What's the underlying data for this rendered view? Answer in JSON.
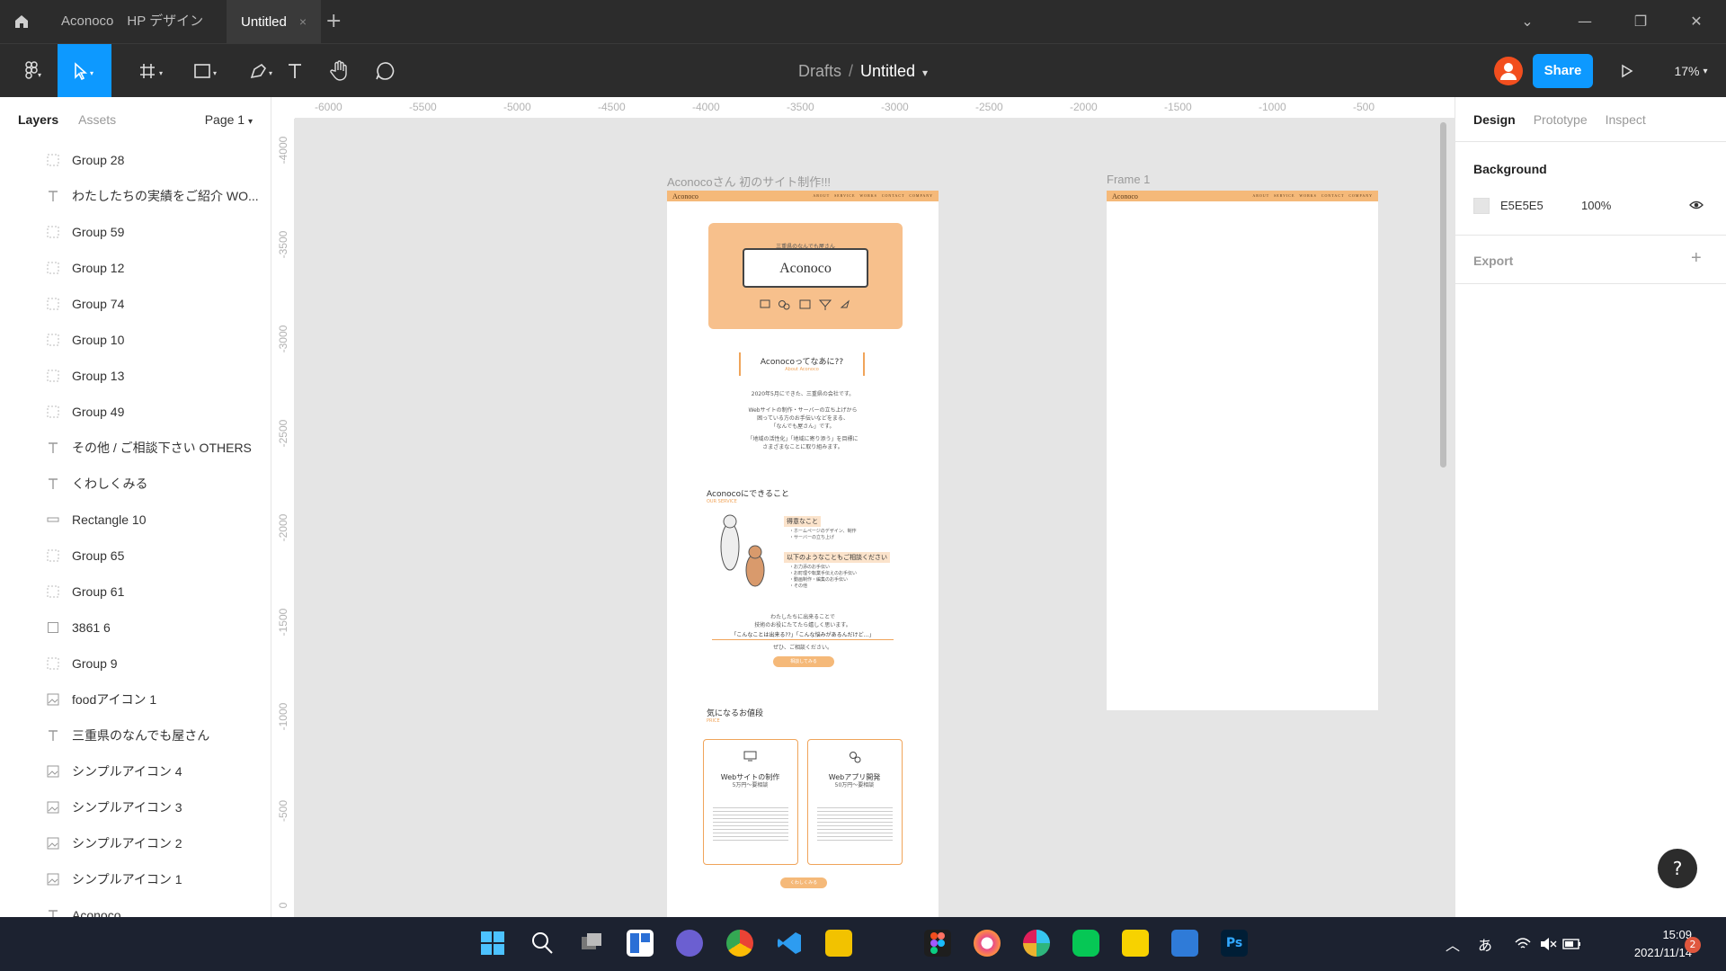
{
  "titlebar": {
    "tabs": [
      {
        "label": "Aconoco　HP デザイン"
      },
      {
        "label": "Untitled",
        "close": "×"
      }
    ],
    "plus": "+",
    "controls": [
      "⌄",
      "—",
      "❐",
      "✕"
    ]
  },
  "toolbar": {
    "breadcrumb_parent": "Drafts",
    "breadcrumb_sep": "/",
    "file_name": "Untitled",
    "share_label": "Share",
    "zoom": "17%"
  },
  "left_panel": {
    "tab_layers": "Layers",
    "tab_assets": "Assets",
    "page": "Page 1",
    "layers": [
      {
        "type": "group",
        "name": "Group 28"
      },
      {
        "type": "text",
        "name": "わたしたちの実績をご紹介 WO..."
      },
      {
        "type": "group",
        "name": "Group 59"
      },
      {
        "type": "group",
        "name": "Group 12"
      },
      {
        "type": "group",
        "name": "Group 74"
      },
      {
        "type": "group",
        "name": "Group 10"
      },
      {
        "type": "group",
        "name": "Group 13"
      },
      {
        "type": "group",
        "name": "Group 49"
      },
      {
        "type": "text",
        "name": "その他 / ご相談下さい OTHERS"
      },
      {
        "type": "text",
        "name": "くわしくみる"
      },
      {
        "type": "rect",
        "name": "Rectangle 10"
      },
      {
        "type": "group",
        "name": "Group 65"
      },
      {
        "type": "group",
        "name": "Group 61"
      },
      {
        "type": "frame",
        "name": "3861 6"
      },
      {
        "type": "group",
        "name": "Group 9"
      },
      {
        "type": "image",
        "name": "foodアイコン 1"
      },
      {
        "type": "text",
        "name": "三重県のなんでも屋さん"
      },
      {
        "type": "image",
        "name": "シンプルアイコン 4"
      },
      {
        "type": "image",
        "name": "シンプルアイコン 3"
      },
      {
        "type": "image",
        "name": "シンプルアイコン 2"
      },
      {
        "type": "image",
        "name": "シンプルアイコン 1"
      },
      {
        "type": "text",
        "name": "Aconoco"
      }
    ]
  },
  "rulers": {
    "top": [
      "-6000",
      "-5500",
      "-5000",
      "-4500",
      "-4000",
      "-3500",
      "-3000",
      "-2500",
      "-2000",
      "-1500",
      "-1000",
      "-500"
    ],
    "left": [
      "-4000",
      "-3500",
      "-3000",
      "-2500",
      "-2000",
      "-1500",
      "-1000",
      "-500",
      "0"
    ]
  },
  "canvas": {
    "frame1_label": "Aconocoさん 初のサイト制作!!!",
    "frame2_label": "Frame 1",
    "site": {
      "logo": "Aconoco",
      "nav": "ABOUT　SERVICE　WORKS　CONTACT　COMPANY",
      "hero_tagline": "三重県のなんでも屋さん",
      "hero_title": "Aconoco",
      "about_title": "Aconocoってなあに??",
      "about_sub": "About Aconoco",
      "about_p1": "2020年5月にできた、三重県の会社です。",
      "about_p2": "Webサイトの制作・サーバーの立ち上げから\n困っている方のお手伝いなどをまる、\n「なんでも屋さん」です。",
      "about_p3": "「地域の活性化」「地域に寄り添う」を目標に\nさまざまなことに取り組みます。",
      "service_title": "Aconocoにできること",
      "service_sub": "OUR SERVICE",
      "good_title": "得意なこと",
      "good_items": "・ホームページのデザイン、制作\n・サーバーの立ち上げ",
      "also_title": "以下のようなこともご相談ください",
      "also_items": "・お力添のお手伝い\n・お町理や転業手伝えのお手伝い\n・動画制作・編集のお手伝い\n・その他",
      "cta_text": "わたしたちに出来ることで\n技術のお役にたてたら嬉しく思います。",
      "cta_quote": "「こんなことは出来る??」「こんな悩みがあるんだけど…」",
      "cta_text2": "ぜひ、ご相談ください。",
      "cta_button": "相談してみる",
      "price_title": "気になるお値段",
      "price_sub": "PRICE",
      "card1_title": "Webサイトの制作",
      "card1_price": "5万円〜要相談",
      "card2_title": "Webアプリ開発",
      "card2_price": "50万円〜要相談",
      "more_button": "くわしくみる"
    },
    "frame2_logo": "Aconoco",
    "frame2_nav": "ABOUT　SERVICE　WORKS　CONTACT　COMPANY"
  },
  "right_panel": {
    "tabs": [
      "Design",
      "Prototype",
      "Inspect"
    ],
    "background_label": "Background",
    "bg_hex": "E5E5E5",
    "bg_opacity": "100%",
    "export_label": "Export",
    "add": "+"
  },
  "help": "?",
  "taskbar": {
    "time": "15:09",
    "date": "2021/11/14",
    "ime": "あ",
    "badge": "2"
  },
  "colors": {
    "accent": "#0d99ff",
    "brand": "#f5b979",
    "canvas": "#e5e5e5"
  }
}
